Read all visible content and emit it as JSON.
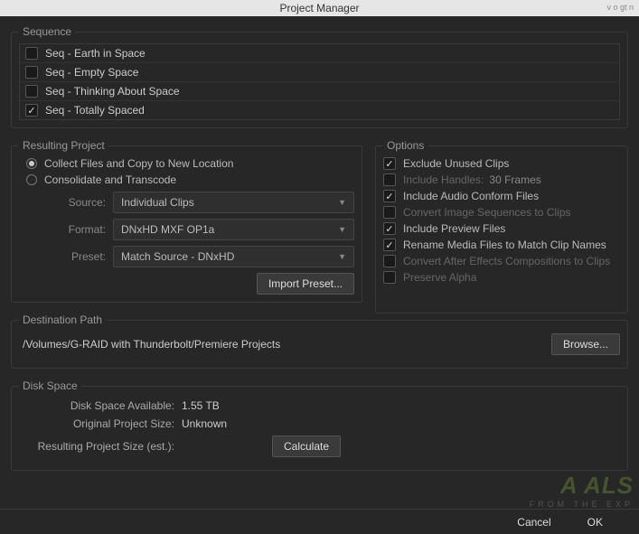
{
  "title": "Project Manager",
  "sequence": {
    "legend": "Sequence",
    "items": [
      {
        "label": "Seq - Earth in Space",
        "checked": false
      },
      {
        "label": "Seq - Empty Space",
        "checked": false
      },
      {
        "label": "Seq - Thinking About Space",
        "checked": false
      },
      {
        "label": "Seq - Totally Spaced",
        "checked": true
      }
    ]
  },
  "resulting": {
    "legend": "Resulting Project",
    "radios": [
      {
        "label": "Collect Files and Copy to New Location",
        "selected": true
      },
      {
        "label": "Consolidate and Transcode",
        "selected": false
      }
    ],
    "source_label": "Source:",
    "source_value": "Individual Clips",
    "format_label": "Format:",
    "format_value": "DNxHD MXF OP1a",
    "preset_label": "Preset:",
    "preset_value": "Match Source - DNxHD",
    "import_preset": "Import Preset..."
  },
  "options": {
    "legend": "Options",
    "items": [
      {
        "label": "Exclude Unused Clips",
        "checked": true,
        "enabled": true
      },
      {
        "label": "Include Handles:",
        "checked": false,
        "enabled": false,
        "extra": "30 Frames"
      },
      {
        "label": "Include Audio Conform Files",
        "checked": true,
        "enabled": true
      },
      {
        "label": "Convert Image Sequences to Clips",
        "checked": false,
        "enabled": false
      },
      {
        "label": "Include Preview Files",
        "checked": true,
        "enabled": true
      },
      {
        "label": "Rename Media Files to Match Clip Names",
        "checked": true,
        "enabled": true
      },
      {
        "label": "Convert After Effects Compositions to Clips",
        "checked": false,
        "enabled": false
      },
      {
        "label": "Preserve Alpha",
        "checked": false,
        "enabled": false
      }
    ]
  },
  "destination": {
    "legend": "Destination Path",
    "path": "/Volumes/G-RAID with Thunderbolt/Premiere Projects",
    "browse": "Browse..."
  },
  "disk": {
    "legend": "Disk Space",
    "available_label": "Disk Space Available:",
    "available_value": "1.55 TB",
    "original_label": "Original Project Size:",
    "original_value": "Unknown",
    "resulting_label": "Resulting Project Size (est.):",
    "calculate": "Calculate"
  },
  "footer": {
    "cancel": "Cancel",
    "ok": "OK"
  },
  "watermark": {
    "top": "A  ALS",
    "bot": "FROM THE EXP"
  },
  "corner": "v o gt n"
}
